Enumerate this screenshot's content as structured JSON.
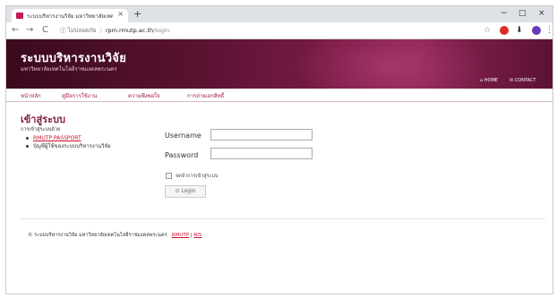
{
  "browser": {
    "tab_title": "ระบบบริหารงานวิจัย มหาวิทยาลัยเทคโนโลยี...",
    "tab_close": "×",
    "new_tab": "+",
    "window_controls": {
      "minimize": "−",
      "maximize": "□",
      "close": "×"
    },
    "nav": {
      "back": "←",
      "forward": "→",
      "reload": "C"
    },
    "address": {
      "security_label": "ไม่ปลอดภัย",
      "host": "rpm.rmutp.ac.th",
      "path": "/login"
    },
    "toolbar_icons": {
      "star": "☆",
      "extension": "●",
      "download": "⬇",
      "menu": "⋮"
    },
    "colors": {
      "extension_red": "#d93025",
      "profile_purple": "#673ab7"
    }
  },
  "site": {
    "title": "ระบบบริหารงานวิจัย",
    "subtitle": "มหาวิทยาลัยเทคโนโลยีราชมงคลพระนคร",
    "header_links": {
      "home": "⌂ HOME",
      "contact": "✉ CONTACT"
    },
    "menu": [
      "หน้าหลัก",
      "คู่มือการใช้งาน",
      "ความพึงพอใจ",
      "การถ่ายเอกสิทธิ์"
    ],
    "brand_color": "#7a1b45"
  },
  "login": {
    "heading": "เข้าสู่ระบบ",
    "via_label": "การเข้าสู่ระบบด้วย",
    "options": [
      "RMUTP PASSPORT",
      "บัญชีผู้ใช้ของระบบบริหารงานวิจัย"
    ],
    "username_label": "Username",
    "password_label": "Password",
    "username_value": "",
    "password_value": "",
    "remember_label": "จดจำการเข้าสู่ระบบ",
    "login_button": "⊙ Login"
  },
  "footer": {
    "text": "© ระบบบริหารงานวิจัย มหาวิทยาลัยเทคโนโลยีราชมงคลพระนคร",
    "links": [
      "RMUTP",
      "|",
      "RIS"
    ]
  }
}
